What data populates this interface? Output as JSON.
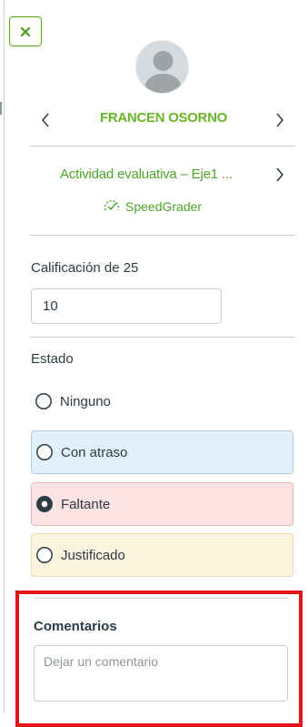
{
  "header": {
    "close_icon": "close-icon",
    "avatar_icon": "user-avatar-icon",
    "prev_icon": "chevron-left-icon",
    "next_icon": "chevron-right-icon",
    "student_name": "FRANCEN OSORNO"
  },
  "assignment": {
    "title": "Actividad evaluativa – Eje1 ...",
    "next_icon": "chevron-right-icon",
    "speedgrader_label": "SpeedGrader",
    "speedgrader_icon": "speedgrader-icon"
  },
  "grade": {
    "label": "Calificación de 25",
    "value": "10"
  },
  "status": {
    "label": "Estado",
    "options": [
      {
        "label": "Ninguno",
        "selected": false
      },
      {
        "label": "Con atraso",
        "selected": false
      },
      {
        "label": "Faltante",
        "selected": true
      },
      {
        "label": "Justificado",
        "selected": false
      }
    ]
  },
  "comments": {
    "label": "Comentarios",
    "placeholder": "Dejar un comentario"
  },
  "colors": {
    "accent_green": "#6ab42a",
    "highlight_red": "#e3151a",
    "late_bg": "#e3f0f9",
    "missing_bg": "#fbe3e3",
    "excused_bg": "#fdf4e0"
  }
}
